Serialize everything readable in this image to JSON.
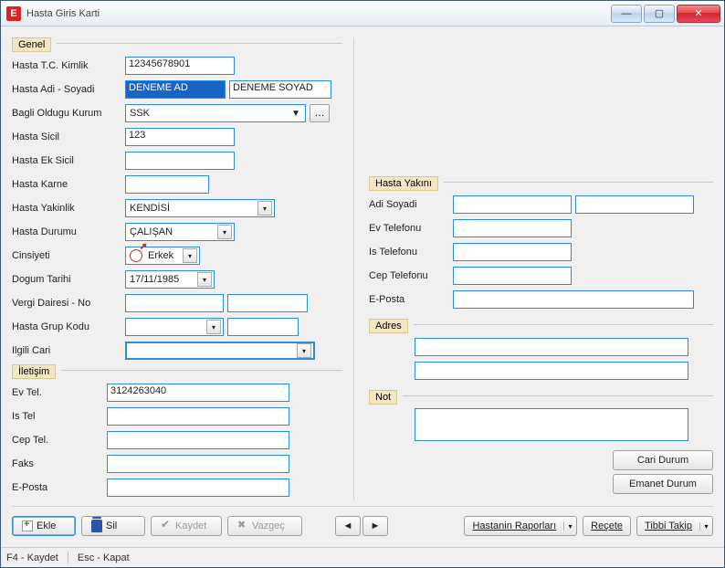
{
  "window": {
    "title": "Hasta Giris Karti",
    "icon_text": "E"
  },
  "groups": {
    "genel": "Genel",
    "iletisim": "İletişim",
    "hasta_yakini": "Hasta Yakını",
    "adres": "Adres",
    "not": "Not"
  },
  "labels": {
    "tc_kimlik": "Hasta T.C. Kimlik",
    "adi_soyadi": "Hasta Adi - Soyadi",
    "bagli_kurum": "Bagli Oldugu Kurum",
    "sicil": "Hasta Sicil",
    "ek_sicil": "Hasta Ek Sicil",
    "karne": "Hasta Karne",
    "yakinlik": "Hasta Yakinlik",
    "durumu": "Hasta Durumu",
    "cinsiyeti": "Cinsiyeti",
    "dogum": "Dogum Tarihi",
    "vergi": "Vergi Dairesi - No",
    "grup_kodu": "Hasta Grup Kodu",
    "ilgili_cari": "Ilgili Cari",
    "ev_tel": "Ev Tel.",
    "is_tel": "Is Tel",
    "cep_tel": "Cep Tel.",
    "faks": "Faks",
    "eposta": "E-Posta",
    "yk_adi": "Adi Soyadi",
    "yk_ev": "Ev Telefonu",
    "yk_is": "Is Telefonu",
    "yk_cep": "Cep Telefonu",
    "yk_eposta": "E-Posta"
  },
  "values": {
    "tc_kimlik": "12345678901",
    "adi": "DENEME AD",
    "soyadi": "DENEME SOYAD",
    "bagli_kurum": "SSK",
    "sicil": "123",
    "ek_sicil": "",
    "karne": "",
    "yakinlik": "KENDİSİ",
    "durumu": "ÇALIŞAN",
    "cinsiyeti": "Erkek",
    "dogum": "17/11/1985",
    "vergi_daire": "",
    "vergi_no": "",
    "grup_kodu": "",
    "grup_kodu2": "",
    "ilgili_cari": "",
    "ev_tel": "3124263040",
    "is_tel": "",
    "cep_tel": "",
    "faks": "",
    "eposta": "",
    "yk_adi1": "",
    "yk_adi2": "",
    "yk_ev": "",
    "yk_is": "",
    "yk_cep": "",
    "yk_eposta": "",
    "adres1": "",
    "adres2": "",
    "not": ""
  },
  "buttons": {
    "cari_durum": "Cari Durum",
    "emanet_durum": "Emanet Durum",
    "ekle": "Ekle",
    "sil": "Sil",
    "kaydet": "Kaydet",
    "vazgec": "Vazgeç",
    "raporlar": "Hastanin Raporları",
    "recete": "Reçete",
    "tibbi": "Tibbi Takip",
    "nav_prev": "◄",
    "nav_next": "►",
    "more": "…"
  },
  "statusbar": {
    "f4": "F4 - Kaydet",
    "esc": "Esc - Kapat"
  }
}
